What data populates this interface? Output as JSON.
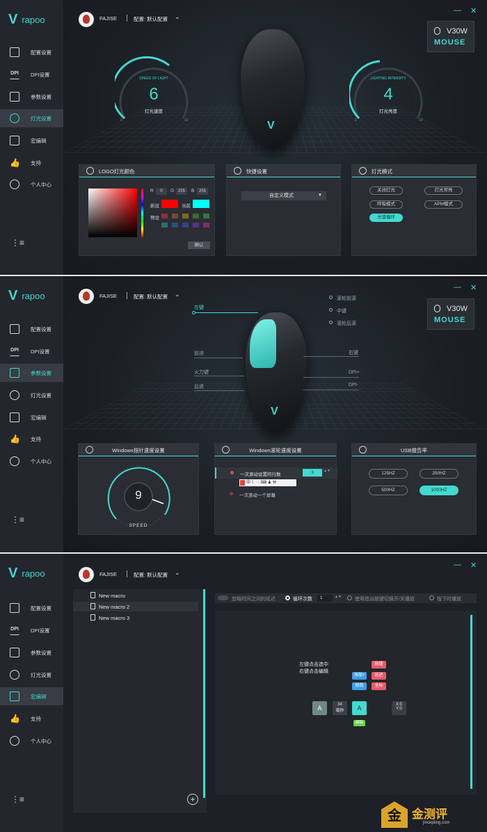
{
  "app": {
    "logo_text": "rapoo",
    "user_name": "FAJISE",
    "profile_label": "配置: 默认配置",
    "minimize_icon": "—",
    "close_icon": "✕",
    "badge_model": "V30W",
    "badge_brand": "MOUSE",
    "accent_color": "#43d9cf"
  },
  "nav": {
    "items": [
      {
        "label": "配置设置",
        "icon": "config-icon"
      },
      {
        "label": "DPI设置",
        "icon": "dpi-icon"
      },
      {
        "label": "参数设置",
        "icon": "sliders-icon"
      },
      {
        "label": "灯光设置",
        "icon": "bulb-icon"
      },
      {
        "label": "宏编辑",
        "icon": "macro-icon"
      },
      {
        "label": "支持",
        "icon": "thumbs-up-icon"
      },
      {
        "label": "个人中心",
        "icon": "user-icon"
      }
    ],
    "collapse_icon": "⋮≡"
  },
  "lighting": {
    "speed_gauge": {
      "title": "SPEED OF LIGHT",
      "value": "6",
      "label": "灯光速度",
      "min": "0",
      "max": "10"
    },
    "intensity_gauge": {
      "title": "LIGHTING INTENSITY",
      "value": "4",
      "label": "灯光亮度",
      "min": "0",
      "max": "10"
    },
    "logo_card": {
      "title": "LOGO灯光颜色",
      "r_label": "R",
      "r_value": "0",
      "g_label": "G",
      "g_value": "255",
      "b_label": "B",
      "b_value": "255",
      "new_label": "新设",
      "current_label": "当前",
      "preset_label": "预设",
      "new_color": "#ff0000",
      "current_color": "#00ffff",
      "presets": [
        "#8c2f3a",
        "#7a4a2a",
        "#7d6a23",
        "#3f6b2b",
        "#2e7a3e",
        "#2e6e6a",
        "#2a4f7a",
        "#3a3f8a",
        "#5a2f8a",
        "#7a2f6a"
      ],
      "confirm": "确认"
    },
    "shortcut_card": {
      "title": "快捷设置",
      "mode": "自定义模式"
    },
    "mode_card": {
      "title": "灯光模式",
      "modes": [
        "关闭灯光",
        "灯光常亮",
        "呼吸模式",
        "APM模式",
        "光谱循环"
      ],
      "active_mode": "光谱循环"
    }
  },
  "params": {
    "callouts": {
      "left": "左键",
      "wheel_forward": "滚轮前滚",
      "middle": "中键",
      "wheel_back": "滚轮后滚",
      "forward": "前进",
      "right": "右键",
      "fire": "火力键",
      "dpi_plus": "DPI+",
      "back": "后退",
      "dpi_minus": "DPI-"
    },
    "pointer_card": {
      "title": "Windows指针速度设置",
      "value": "9",
      "label": "SPEED"
    },
    "scroll_card": {
      "title": "Windows滚轮速度设置",
      "opt1": "一次滚动设置的行数",
      "lines": "3",
      "opt2": "一次滚动一个屏幕",
      "ime_bar": "中 ☾ ·· ⌨ ♟ ⚒"
    },
    "usb_card": {
      "title": "USB报告率",
      "rates": [
        "125HZ",
        "250HZ",
        "500HZ",
        "1000HZ"
      ],
      "active_rate": "1000HZ"
    }
  },
  "macro": {
    "list": [
      "New macro",
      "New macro 2",
      "New macro 3"
    ],
    "add_icon": "+",
    "toolbar": {
      "ignore_delay": "忽略时间之间的延迟",
      "loop_count_label": "循环次数",
      "loop_count": "1",
      "toggle_mode": "使用指派按键切换开/关播放",
      "hold_mode": "按下时播放"
    },
    "hint": {
      "line1": "左键点击选中",
      "line2": "右键点击编辑"
    },
    "nodes": {
      "key": "按键",
      "add": "添加+",
      "delay": "延迟",
      "edit": "修改",
      "coord": "坐标",
      "key_a": "A",
      "time_value": "34",
      "time_unit": "毫秒",
      "x0": "X:0",
      "y0": "Y:0",
      "delete": "删除"
    }
  },
  "watermark": {
    "brand": "金测评",
    "url": "jincepting.com"
  }
}
